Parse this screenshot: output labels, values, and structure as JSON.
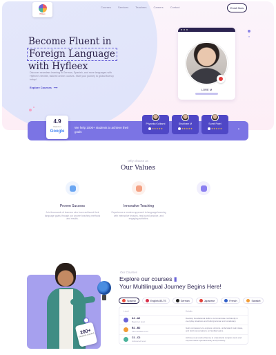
{
  "header": {
    "logo_text": "Hyfleex",
    "nav": [
      "Courses",
      "Services",
      "Teachers",
      "Careers",
      "Contact"
    ],
    "enroll_label": "Enroll Now"
  },
  "hero": {
    "title_line1": "Become Fluent in",
    "title_line2": "Foreign Language",
    "title_line3": "with Hyfleex",
    "subtitle": "Discover seamless learning in German, Spanish, and more languages with Hyfleex's flexible, tailored online courses. Start your journey to global fluency today!",
    "cta": "Explore Courses",
    "teacher_name": "LORE M"
  },
  "stats": {
    "rating": "4.9",
    "rating_caption": "Rated on",
    "rating_source": "Google",
    "helped_text": "We help 1000+ students to achieve their goals",
    "testimonials": [
      {
        "name": "Priyanka Kulkarni",
        "stars": "★★★★★"
      },
      {
        "name": "Shubham M",
        "stars": "★★★★★"
      },
      {
        "name": "Sumit Patel",
        "stars": "★★★★★"
      }
    ],
    "next_arrow": "›"
  },
  "values": {
    "eyebrow": "Why choose us",
    "title": "Our Values",
    "items": [
      {
        "title": "Proven Success",
        "desc": "Join thousands of learners who have achieved their language goals through our proven teaching methods and results.",
        "color": "#6aa6f2"
      },
      {
        "title": "Innovative Teaching",
        "desc": "Experience a modern approach to language learning with interactive lessons, real-world practice, and engaging activities.",
        "color": "#f4a183"
      },
      {
        "title": "",
        "desc": "",
        "color": "#8b7ff0"
      }
    ]
  },
  "courses": {
    "eyebrow": "Our Courses",
    "title_line1": "Explore our courses",
    "title_line2": "Your Multilingual Journey Begins Here!",
    "badge_number": "200+",
    "badge_label": "Students enrolled",
    "tabs": [
      {
        "label": "Spanish",
        "color": "#e94b3c"
      },
      {
        "label": "English-IELTS",
        "color": "#d8304a"
      },
      {
        "label": "German",
        "color": "#222222"
      },
      {
        "label": "Japanese",
        "color": "#e0403a"
      },
      {
        "label": "French",
        "color": "#2e5ec9"
      },
      {
        "label": "Sanskrit",
        "color": "#f29c34"
      }
    ],
    "table_head_level": "Level",
    "table_head_desc": "Details",
    "rows": [
      {
        "level": "A1 - A2",
        "sub": "Beginner level",
        "desc": "Develop foundational skills to communicate confidently in everyday situations and build grammar and vocabulary.",
        "color": "#6a63d8"
      },
      {
        "level": "B1 - B2",
        "sub": "Intermediate level",
        "desc": "Gain competence to express opinions, understand main ideas, and hold conversations on familiar topics.",
        "color": "#f29c34"
      },
      {
        "level": "C1 - C2",
        "sub": "Advanced level",
        "desc": "Achieve near-native fluency to understand complex texts and express ideas spontaneously and precisely.",
        "color": "#4bb39a"
      }
    ]
  }
}
